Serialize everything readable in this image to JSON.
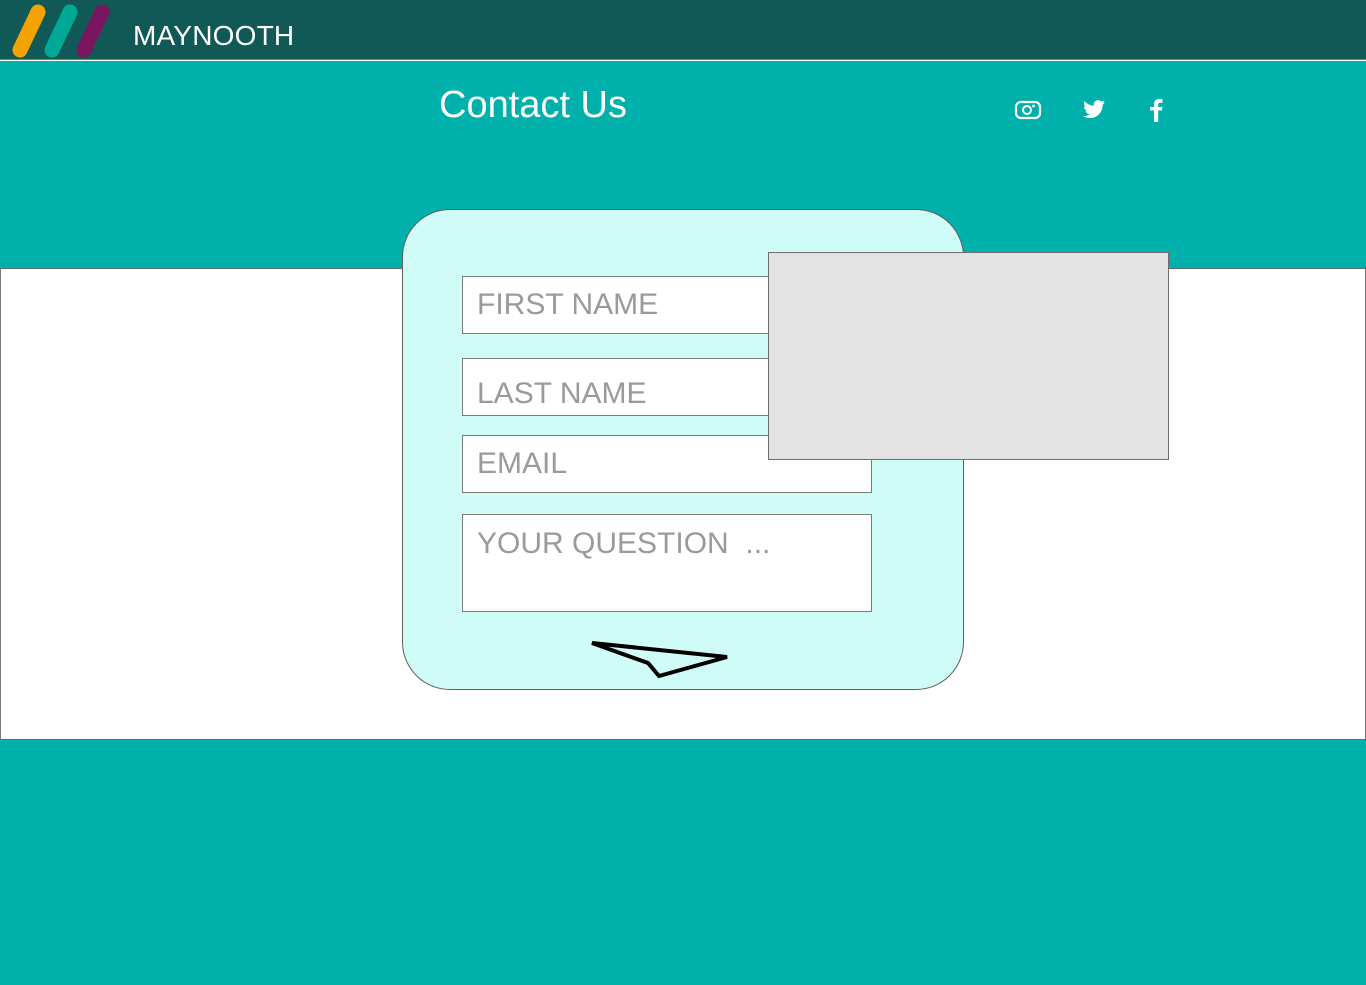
{
  "header": {
    "brand": "MAYNOOTH",
    "logo_stripe_colors": [
      "#f4a300",
      "#00a896",
      "#7a1560"
    ]
  },
  "hero": {
    "title": "Contact Us",
    "social": [
      {
        "icon": "instagram-icon"
      },
      {
        "icon": "twitter-icon"
      },
      {
        "icon": "facebook-icon"
      }
    ]
  },
  "form": {
    "first_name_placeholder": "FIRST NAME",
    "last_name_placeholder": "LAST NAME",
    "email_placeholder": "EMAIL",
    "question_placeholder": "YOUR QUESTION  ...",
    "submit_icon": "paper-plane-icon"
  },
  "colors": {
    "topbar": "#115956",
    "teal": "#00b0aa",
    "card": "#d0fcf8",
    "placeholder_box": "#e3e3e3"
  }
}
